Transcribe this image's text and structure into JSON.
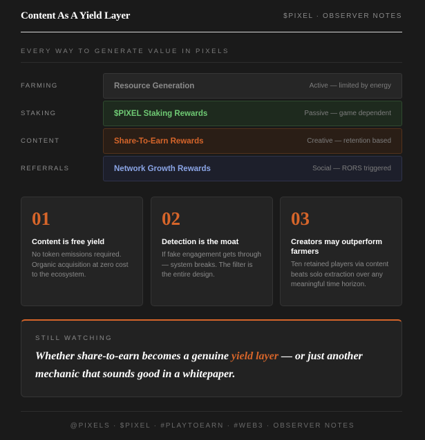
{
  "header": {
    "title": "Content As A Yield Layer",
    "meta": "$PIXEL · OBSERVER NOTES"
  },
  "section": {
    "label": "EVERY WAY TO GENERATE VALUE IN PIXELS"
  },
  "rows": [
    {
      "label": "FARMING",
      "name": "Resource Generation",
      "desc": "Active — limited by energy"
    },
    {
      "label": "STAKING",
      "name": "$PIXEL Staking Rewards",
      "desc": "Passive — game dependent"
    },
    {
      "label": "CONTENT",
      "name": "Share-To-Earn Rewards",
      "desc": "Creative — retention based"
    },
    {
      "label": "REFERRALS",
      "name": "Network Growth Rewards",
      "desc": "Social — RORS triggered"
    }
  ],
  "cards": [
    {
      "num": "01",
      "title": "Content is free yield",
      "text": "No token emissions required. Organic acquisition at zero cost to the ecosystem."
    },
    {
      "num": "02",
      "title": "Detection is the moat",
      "text": "If fake engagement gets through — system breaks. The filter is the entire design."
    },
    {
      "num": "03",
      "title": "Creators may outperform farmers",
      "text": "Ten retained players via content beats solo extraction over any meaningful time horizon."
    }
  ],
  "quote": {
    "label": "STILL WATCHING",
    "text_before": "Whether share-to-earn becomes a genuine ",
    "highlight": "yield layer",
    "text_after": " — or just another mechanic that sounds good in a whitepaper."
  },
  "footer": {
    "text": "@PIXELS · $PIXEL · #PLAYTOEARN · #WEB3 · OBSERVER NOTES"
  },
  "colors": {
    "accent": "#d6652a",
    "staking": "#6fca74",
    "referrals": "#8ba5e6",
    "background": "#1a1a1a"
  }
}
